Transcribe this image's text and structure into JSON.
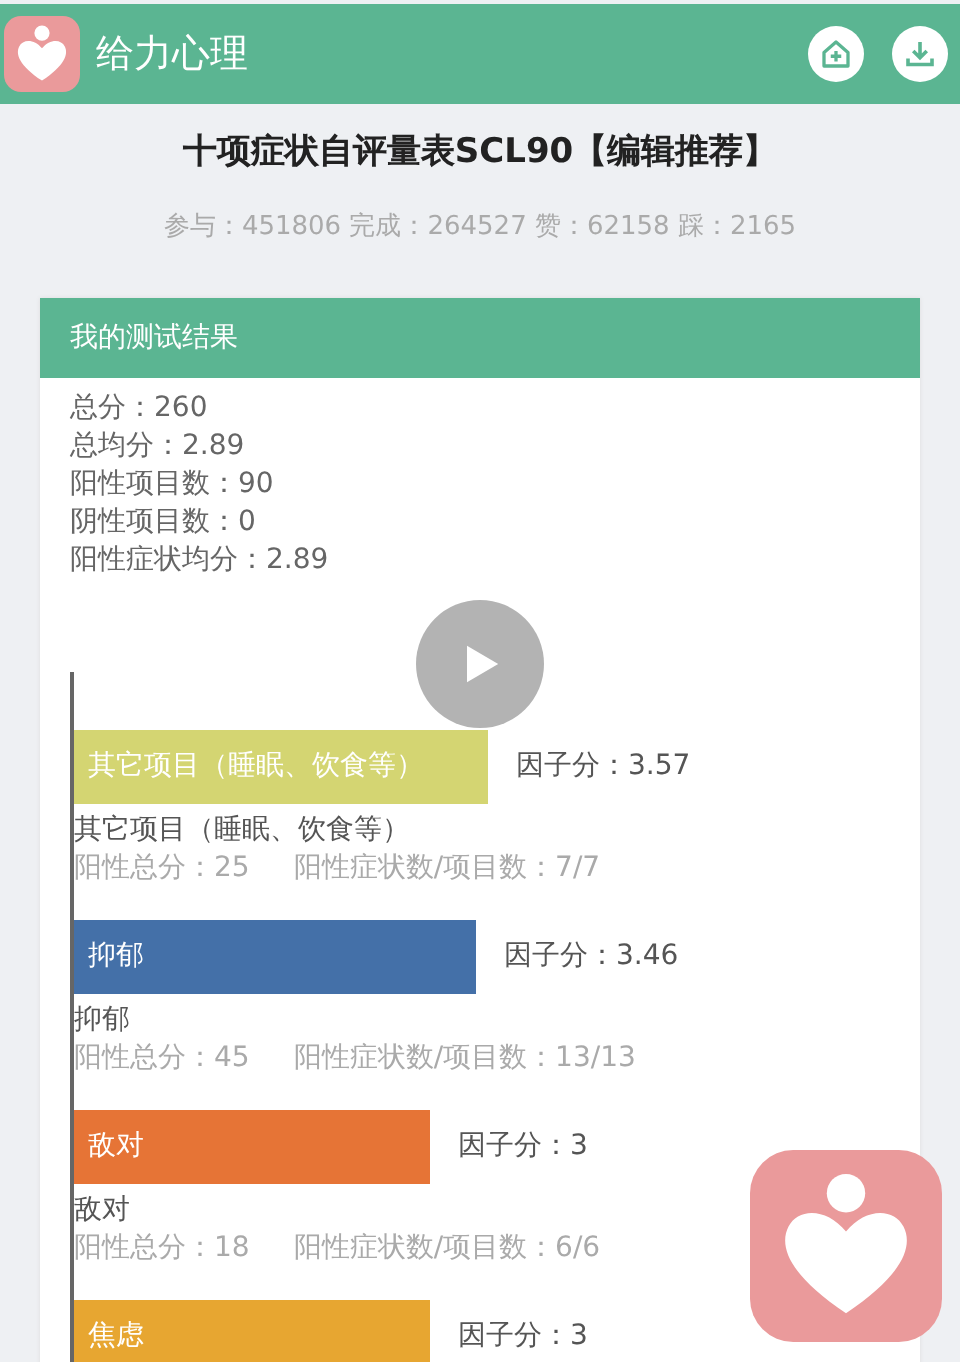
{
  "app_bar": {
    "title": "给力心理"
  },
  "title": "十项症状自评量表SCL90【编辑推荐】",
  "stats": "参与：451806 完成：264527 赞：62158 踩：2165",
  "result_card": {
    "title": "我的测试结果",
    "summary": [
      "总分：260",
      "总均分：2.89",
      "阳性项目数：90",
      "阴性项目数：0",
      "阳性症状均分：2.89"
    ],
    "factors": [
      {
        "bar_label": "其它项目（睡眠、饮食等）",
        "color": "#d4d572",
        "score": "因子分：3.57",
        "name": "其它项目（睡眠、饮食等）",
        "positive_total": "阳性总分：25",
        "ratio": "阳性症状数/项目数：7/7"
      },
      {
        "bar_label": "抑郁",
        "color": "#4470a8",
        "score": "因子分：3.46",
        "name": "抑郁",
        "positive_total": "阳性总分：45",
        "ratio": "阳性症状数/项目数：13/13"
      },
      {
        "bar_label": "敌对",
        "color": "#e67436",
        "score": "因子分：3",
        "name": "敌对",
        "positive_total": "阳性总分：18",
        "ratio": "阳性症状数/项目数：6/6"
      },
      {
        "bar_label": "焦虑",
        "color": "#e7a631",
        "score": "因子分：3"
      }
    ]
  }
}
